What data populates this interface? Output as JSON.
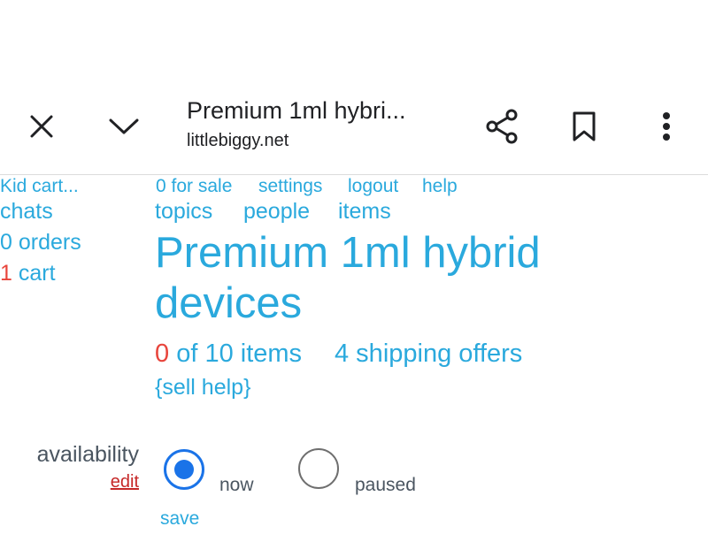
{
  "browser": {
    "page_title": "Premium 1ml hybri...",
    "domain": "littlebiggy.net",
    "icons": [
      "close-icon",
      "chevron-down-icon",
      "share-icon",
      "bookmark-icon",
      "more-vert-icon"
    ]
  },
  "sidebar": {
    "kid_cart": "Kid cart...",
    "chats": "chats",
    "orders": "0 orders",
    "cart_count": "1",
    "cart_label": " cart"
  },
  "topnav": {
    "for_sale": "0 for sale",
    "settings": "settings",
    "logout": "logout",
    "help": "help",
    "topics": "topics",
    "people": "people",
    "items": "items"
  },
  "listing": {
    "title": "Premium 1ml hybrid devices",
    "items_count": "0",
    "items_of": " of 10 items",
    "shipping_offers": "4 shipping offers",
    "sell_help": "{sell help}"
  },
  "availability": {
    "label": "availability",
    "edit": "edit",
    "options": [
      {
        "label": "now",
        "selected": true
      },
      {
        "label": "paused",
        "selected": false
      }
    ],
    "save": "save"
  },
  "colors": {
    "link": "#2aa9dd",
    "alert": "#e8453c",
    "radio_selected": "#1a73e8",
    "edit_link": "#c62828"
  }
}
